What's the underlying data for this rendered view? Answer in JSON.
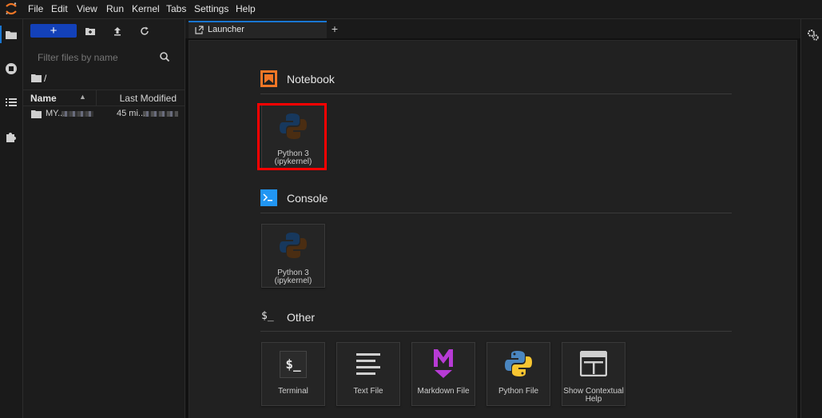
{
  "menubar": {
    "items": [
      "File",
      "Edit",
      "View",
      "Run",
      "Kernel",
      "Tabs",
      "Settings",
      "Help"
    ]
  },
  "filebrowser": {
    "new_label": "+",
    "search_placeholder": "Filter files by name",
    "breadcrumb": "/",
    "columns": {
      "name": "Name",
      "modified": "Last Modified"
    },
    "rows": [
      {
        "name": "MY...",
        "modified": "45 mi..."
      }
    ]
  },
  "tabs": [
    {
      "label": "Launcher"
    }
  ],
  "tab_add_label": "+",
  "launcher": {
    "sections": [
      {
        "title": "Notebook",
        "items": [
          {
            "label_line1": "Python 3",
            "label_line2": "(ipykernel)"
          }
        ]
      },
      {
        "title": "Console",
        "items": [
          {
            "label_line1": "Python 3",
            "label_line2": "(ipykernel)"
          }
        ]
      },
      {
        "title": "Other",
        "items": [
          {
            "label_line1": "Terminal",
            "label_line2": ""
          },
          {
            "label_line1": "Text File",
            "label_line2": ""
          },
          {
            "label_line1": "Markdown File",
            "label_line2": ""
          },
          {
            "label_line1": "Python File",
            "label_line2": ""
          },
          {
            "label_line1": "Show Contextual",
            "label_line2": "Help"
          }
        ]
      }
    ],
    "icons": {
      "terminal_glyph": "$_",
      "markdown_glyph": "M",
      "console_glyph": ">_",
      "other_glyph": "$_"
    }
  },
  "colors": {
    "accent": "#1976d2",
    "new_button": "#1341b9",
    "highlight": "#ff0000",
    "notebook_icon": "#f37726",
    "console_icon": "#2196f3",
    "markdown_icon": "#b73bd5"
  }
}
